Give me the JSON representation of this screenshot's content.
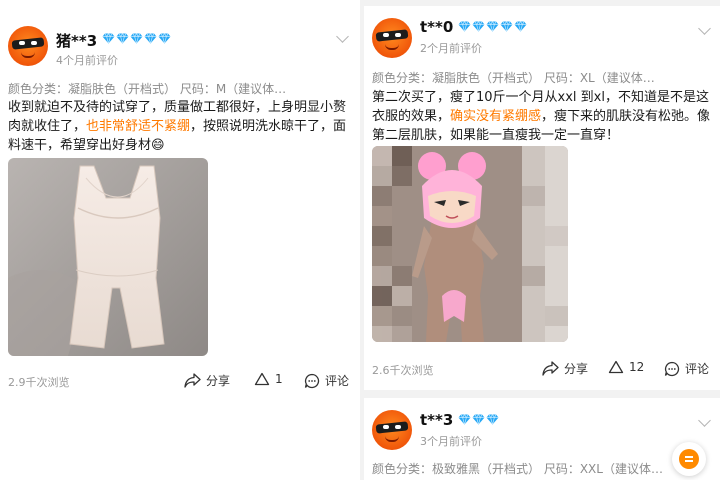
{
  "left_review": {
    "username": "猪**3",
    "time": "4个月前评价",
    "sku": "颜色分类：凝脂肤色（开档式） 尺码：M（建议体…",
    "text_before": "收到就迫不及待的试穿了，质量做工都很好，上身明显小赘肉就收住了，",
    "text_highlight": "也非常舒适不紧绷",
    "text_after": "，按照说明洗水晾干了，面料速干，希望穿出好身材😄",
    "views": "2.9千次浏览",
    "share_label": "分享",
    "like_count": "1",
    "comment_label": "评论"
  },
  "right_review_1": {
    "username": "t**0",
    "time": "2个月前评价",
    "sku": "颜色分类：凝脂肤色（开档式） 尺码：XL（建议体…",
    "text_before": "第二次买了，瘦了10斤一个月从xxl 到xl，不知道是不是这衣服的效果，",
    "text_highlight": "确实没有紧绷感",
    "text_after": "，瘦下来的肌肤没有松弛。像第二层肌肤，如果能一直瘦我一定一直穿！",
    "views": "2.6千次浏览",
    "share_label": "分享",
    "like_count": "12",
    "comment_label": "评论"
  },
  "right_review_2": {
    "username": "t**3",
    "time": "3个月前评价",
    "sku": "颜色分类：极致雅黑（开档式） 尺码：XXL（建议体…"
  },
  "icons": {
    "vip": "diamond-icon",
    "more": "chevron-down-icon",
    "share": "share-icon",
    "like": "like-icon",
    "comment": "comment-icon",
    "fab": "list-icon"
  },
  "colors": {
    "highlight": "#ff7a00",
    "diamond": "#27a8f5",
    "secondary_text": "#999999",
    "fab": "#ff8a00"
  }
}
